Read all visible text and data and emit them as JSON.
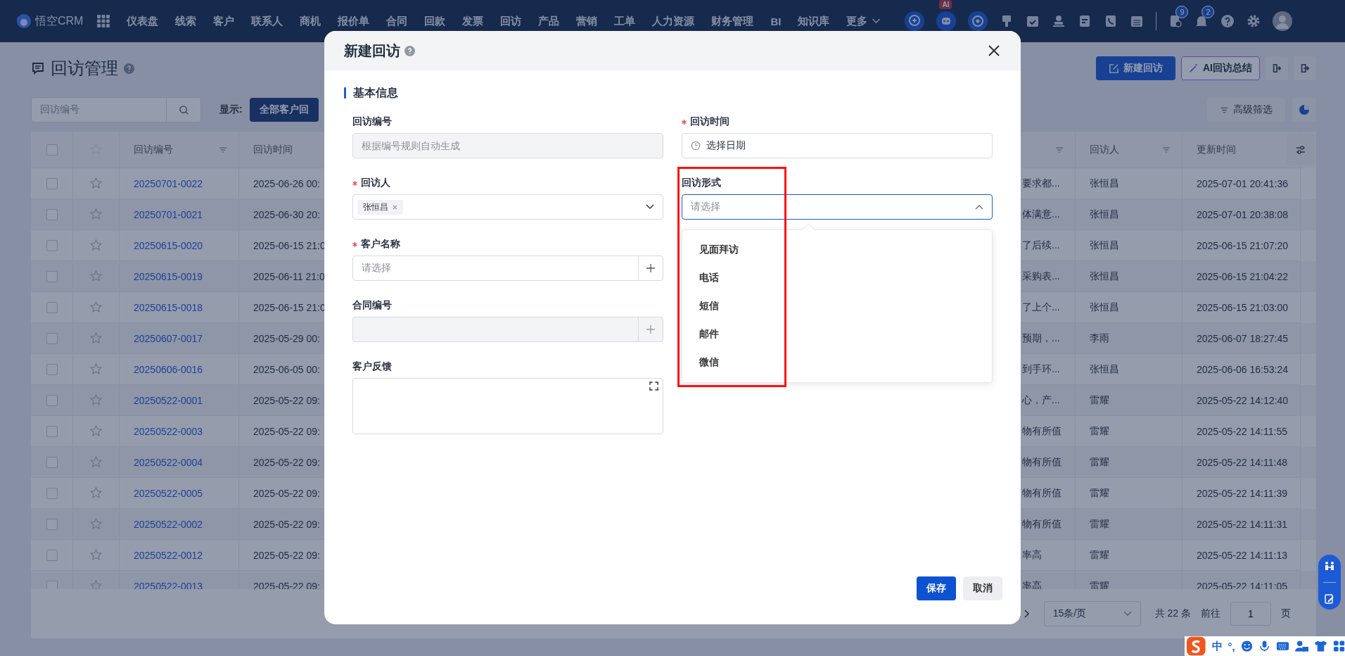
{
  "nav": {
    "logo": "悟空CRM",
    "items": [
      "仪表盘",
      "线索",
      "客户",
      "联系人",
      "商机",
      "报价单",
      "合同",
      "回款",
      "发票",
      "回访",
      "产品",
      "营销",
      "工单",
      "人力资源",
      "财务管理",
      "BI",
      "知识库"
    ],
    "more": "更多",
    "ai_badge": "AI",
    "task_badge": "9",
    "bell_badge": "2"
  },
  "page": {
    "title": "回访管理",
    "search_placeholder": "回访编号",
    "show_label": "显示:",
    "scope_button": "全部客户回",
    "new_button": "新建回访",
    "ai_button": "AI回访总结",
    "filter_button": "高级筛选"
  },
  "table": {
    "select_all": {
      "checked": false
    },
    "columns": [
      {
        "label": "回访编号",
        "filter": true
      },
      {
        "label": "回访时间",
        "filter": false
      },
      {
        "filter": true
      },
      {
        "label": "回访人",
        "filter": true
      },
      {
        "label": "更新时间",
        "filter": false
      }
    ],
    "rows": [
      {
        "checked": false,
        "starred": false,
        "id": "20250701-0022",
        "visit_time": "2025-06-26 00:",
        "column_3": "要求都...",
        "visitor": "张恒昌",
        "updated": "2025-07-01 20:41:36"
      },
      {
        "checked": false,
        "starred": false,
        "id": "20250701-0021",
        "visit_time": "2025-06-30 20:",
        "column_3": "体满意...",
        "visitor": "张恒昌",
        "updated": "2025-07-01 20:38:08"
      },
      {
        "checked": false,
        "starred": false,
        "id": "20250615-0020",
        "visit_time": "2025-06-15 21:0",
        "column_3": "了后续...",
        "visitor": "张恒昌",
        "updated": "2025-06-15 21:07:20"
      },
      {
        "checked": false,
        "starred": false,
        "id": "20250615-0019",
        "visit_time": "2025-06-11 21:0",
        "column_3": "采购表...",
        "visitor": "张恒昌",
        "updated": "2025-06-15 21:04:22"
      },
      {
        "checked": false,
        "starred": false,
        "id": "20250615-0018",
        "visit_time": "2025-06-15 21:0",
        "column_3": "了上个...",
        "visitor": "张恒昌",
        "updated": "2025-06-15 21:03:00"
      },
      {
        "checked": false,
        "starred": false,
        "id": "20250607-0017",
        "visit_time": "2025-05-29 00:",
        "column_3": "预期，...",
        "visitor": "李雨",
        "updated": "2025-06-07 18:27:45"
      },
      {
        "checked": false,
        "starred": false,
        "id": "20250606-0016",
        "visit_time": "2025-06-05 00:",
        "column_3": "到手环...",
        "visitor": "张恒昌",
        "updated": "2025-06-06 16:53:24"
      },
      {
        "checked": false,
        "starred": false,
        "id": "20250522-0001",
        "visit_time": "2025-05-22 09:",
        "column_3": "心，产...",
        "visitor": "雷耀",
        "updated": "2025-05-22 14:12:40"
      },
      {
        "checked": false,
        "starred": false,
        "id": "20250522-0003",
        "visit_time": "2025-05-22 09:",
        "column_3": "物有所值",
        "visitor": "雷耀",
        "updated": "2025-05-22 14:11:55"
      },
      {
        "checked": false,
        "starred": false,
        "id": "20250522-0004",
        "visit_time": "2025-05-22 09:",
        "column_3": "物有所值",
        "visitor": "雷耀",
        "updated": "2025-05-22 14:11:48"
      },
      {
        "checked": false,
        "starred": false,
        "id": "20250522-0005",
        "visit_time": "2025-05-22 09:",
        "column_3": "物有所值",
        "visitor": "雷耀",
        "updated": "2025-05-22 14:11:39"
      },
      {
        "checked": false,
        "starred": false,
        "id": "20250522-0002",
        "visit_time": "2025-05-22 09:",
        "column_3": "物有所值",
        "visitor": "雷耀",
        "updated": "2025-05-22 14:11:31"
      },
      {
        "checked": false,
        "starred": false,
        "id": "20250522-0012",
        "visit_time": "2025-05-22 09:",
        "column_3": "率高",
        "visitor": "雷耀",
        "updated": "2025-05-22 14:11:13"
      },
      {
        "checked": false,
        "starred": false,
        "id": "20250522-0013",
        "visit_time": "2025-05-22 09:",
        "column_3": "率高",
        "visitor": "雷耀",
        "updated": "2025-05-22 14:11:05"
      }
    ]
  },
  "pagination": {
    "page_size": "15条/页",
    "total": "共 22 条",
    "goto": "前往",
    "page": "1",
    "page_suffix": "页"
  },
  "dialog": {
    "title": "新建回访",
    "section": "基本信息",
    "left_fields": [
      {
        "kind": "input",
        "label": "回访编号",
        "required": false,
        "placeholder": "根据编号规则自动生成",
        "disabled": true
      },
      {
        "kind": "tags",
        "label": "回访人",
        "required": true,
        "tags": [
          "张恒昌"
        ]
      },
      {
        "kind": "picker",
        "label": "客户名称",
        "required": true,
        "placeholder": "请选择",
        "disabled": false
      },
      {
        "kind": "picker",
        "label": "合同编号",
        "required": false,
        "disabled": true
      },
      {
        "kind": "textarea",
        "label": "客户反馈",
        "required": false
      }
    ],
    "right_fields": [
      {
        "kind": "date",
        "label": "回访时间",
        "required": true,
        "placeholder": "选择日期"
      },
      {
        "kind": "select",
        "label": "回访形式",
        "required": false,
        "placeholder": "请选择",
        "open": true,
        "options": [
          "见面拜访",
          "电话",
          "短信",
          "邮件",
          "微信"
        ]
      }
    ],
    "save": "保存",
    "cancel": "取消"
  },
  "ime": {
    "mode": "中",
    "punct": "°,"
  }
}
